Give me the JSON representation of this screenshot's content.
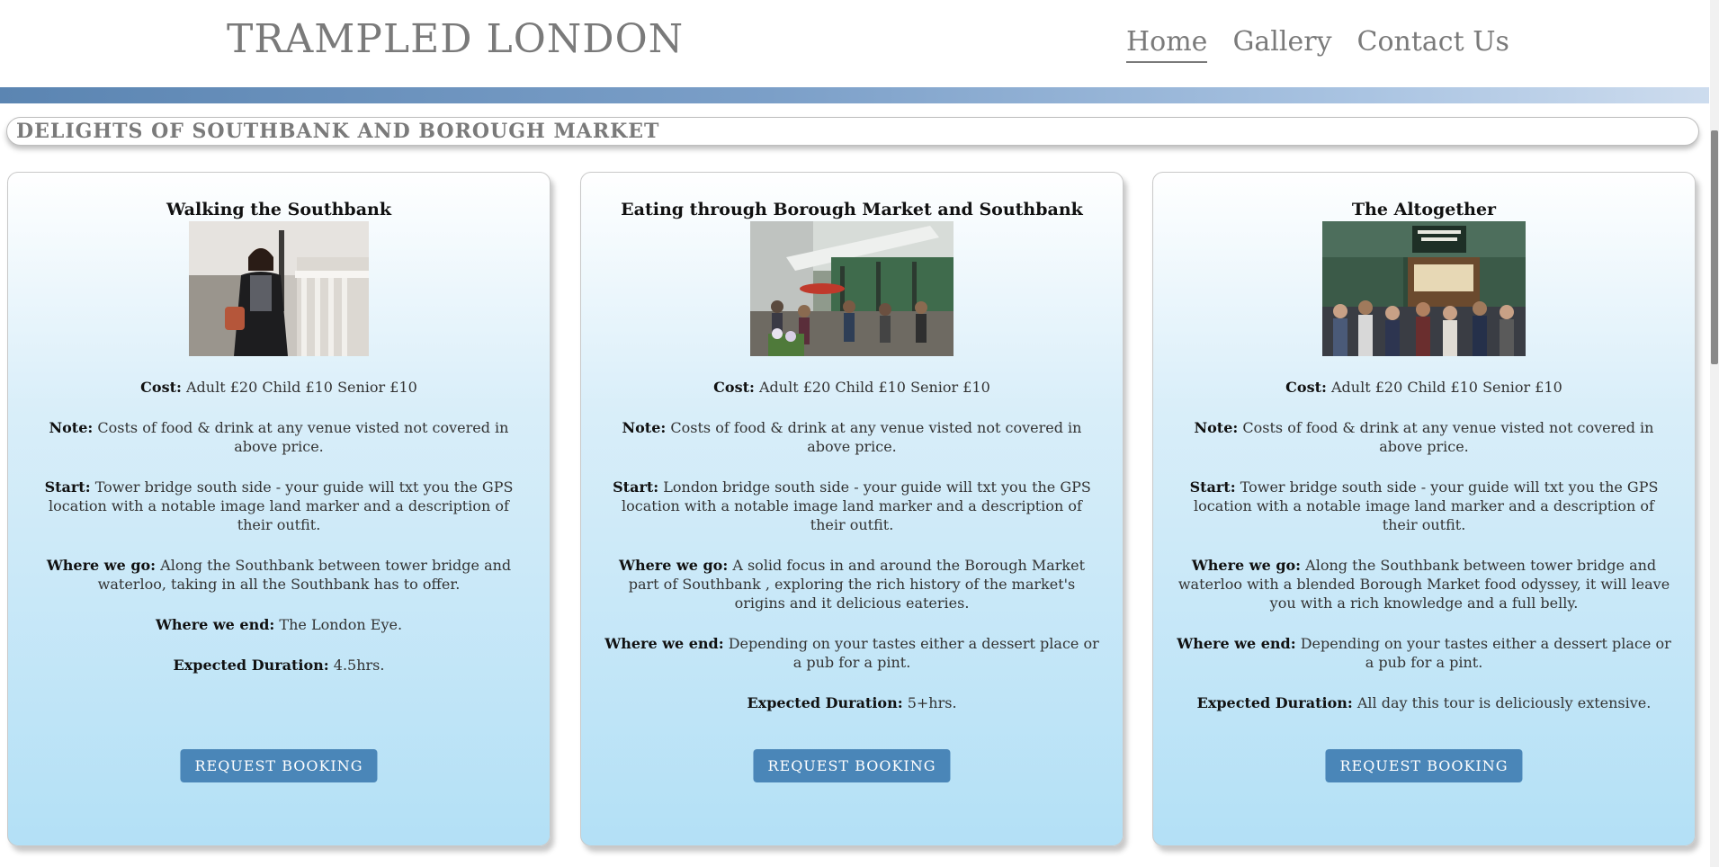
{
  "header": {
    "logo": "TRAMPLED LONDON",
    "nav": [
      {
        "label": "Home",
        "active": true
      },
      {
        "label": "Gallery",
        "active": false
      },
      {
        "label": "Contact Us",
        "active": false
      }
    ]
  },
  "section": {
    "title": "DELIGHTS OF SOUTHBANK AND BOROUGH MARKET"
  },
  "labels": {
    "cost": "Cost:",
    "note": "Note:",
    "start": "Start:",
    "where_go": "Where we go:",
    "where_end": "Where we end:",
    "duration": "Expected Duration:"
  },
  "tours": [
    {
      "title": "Walking the Southbank",
      "image": "woman-on-southbank-photo",
      "cost": "Adult £20 Child £10 Senior £10",
      "note": "Costs of food & drink at any venue visted not covered in above price.",
      "start": "Tower bridge south side - your guide will txt you the GPS location with a notable image land marker and a description of their outfit.",
      "where_go": "Along the Southbank between tower bridge and waterloo, taking in all the Southbank has to offer.",
      "where_end": "The London Eye.",
      "duration": "4.5hrs.",
      "button": "REQUEST BOOKING"
    },
    {
      "title": "Eating through Borough Market and Southbank",
      "image": "borough-market-entrance-photo",
      "cost": "Adult £20 Child £10 Senior £10",
      "note": "Costs of food & drink at any venue visted not covered in above price.",
      "start": "London bridge south side - your guide will txt you the GPS location with a notable image land marker and a description of their outfit.",
      "where_go": "A solid focus in and around the Borough Market part of Southbank , exploring the rich history of the market's origins and it delicious eateries.",
      "where_end": "Depending on your tastes either a dessert place or a pub for a pint.",
      "duration": "5+hrs.",
      "button": "REQUEST BOOKING"
    },
    {
      "title": "The Altogether",
      "image": "borough-market-stall-crowd-photo",
      "cost": "Adult £20 Child £10 Senior £10",
      "note": "Costs of food & drink at any venue visted not covered in above price.",
      "start": "Tower bridge south side - your guide will txt you the GPS location with a notable image land marker and a description of their outfit.",
      "where_go": "Along the Southbank between tower bridge and waterloo with a blended Borough Market food odyssey, it will leave you with a rich knowledge and a full belly.",
      "where_end": "Depending on your tastes either a dessert place or a pub for a pint.",
      "duration": "All day this tour is deliciously extensive.",
      "button": "REQUEST BOOKING"
    }
  ],
  "colors": {
    "stripe_start": "#5b85b2",
    "button": "#4a86b8",
    "card_bottom": "#b3e0f6"
  }
}
